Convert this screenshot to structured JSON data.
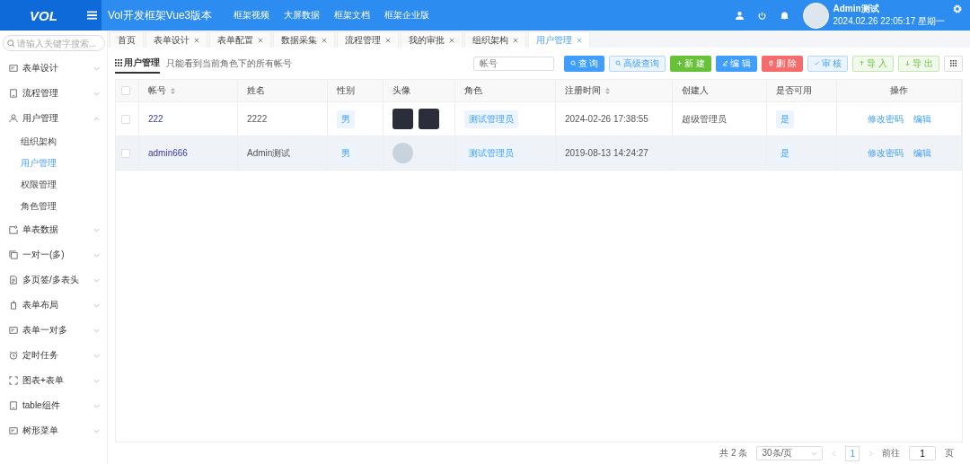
{
  "header": {
    "logo": "VOL",
    "title": "Vol开发框架Vue3版本",
    "nav": [
      "框架视频",
      "大屏数据",
      "框架文档",
      "框架企业版"
    ],
    "user_name": "Admin测试",
    "datetime": "2024.02.26 22:05:17 星期一"
  },
  "sidebar": {
    "search": {
      "placeholder": "请输入关键字搜索..."
    },
    "items": [
      {
        "label": "表单设计",
        "expanded": false
      },
      {
        "label": "流程管理",
        "expanded": false
      },
      {
        "label": "用户管理",
        "expanded": true,
        "children": [
          {
            "label": "组织架构",
            "selected": false
          },
          {
            "label": "用户管理",
            "selected": true
          },
          {
            "label": "权限管理",
            "selected": false
          },
          {
            "label": "角色管理",
            "selected": false
          }
        ]
      },
      {
        "label": "单表数据",
        "expanded": false
      },
      {
        "label": "一对一(多)",
        "expanded": false
      },
      {
        "label": "多页签/多表头",
        "expanded": false
      },
      {
        "label": "表单布局",
        "expanded": false
      },
      {
        "label": "表单一对多",
        "expanded": false
      },
      {
        "label": "定时任务",
        "expanded": false
      },
      {
        "label": "图表+表单",
        "expanded": false
      },
      {
        "label": "table组件",
        "expanded": false
      },
      {
        "label": "树形菜单",
        "expanded": false
      }
    ]
  },
  "tabs": [
    {
      "label": "首页",
      "closable": false,
      "selected": false
    },
    {
      "label": "表单设计",
      "closable": true,
      "selected": false
    },
    {
      "label": "表单配置",
      "closable": true,
      "selected": false
    },
    {
      "label": "数据采集",
      "closable": true,
      "selected": false
    },
    {
      "label": "流程管理",
      "closable": true,
      "selected": false
    },
    {
      "label": "我的审批",
      "closable": true,
      "selected": false
    },
    {
      "label": "组织架构",
      "closable": true,
      "selected": false
    },
    {
      "label": "用户管理",
      "closable": true,
      "selected": true
    }
  ],
  "toolbar": {
    "title": "用户管理",
    "description": "只能看到当前角色下的所有帐号",
    "search": {
      "placeholder": "帐号"
    },
    "buttons": [
      {
        "kind": "search",
        "label": "查 询"
      },
      {
        "kind": "advanced",
        "label": "高级查询"
      },
      {
        "kind": "create",
        "label": "新 建"
      },
      {
        "kind": "edit",
        "label": "编 辑"
      },
      {
        "kind": "delete",
        "label": "删 除"
      },
      {
        "kind": "audit",
        "label": "审 核"
      },
      {
        "kind": "import",
        "label": "导 入"
      },
      {
        "kind": "export",
        "label": "导 出"
      }
    ]
  },
  "table": {
    "select_all_checked": false,
    "columns": [
      {
        "label": "帐号",
        "sortable": true
      },
      {
        "label": "姓名",
        "sortable": false
      },
      {
        "label": "性别",
        "sortable": false
      },
      {
        "label": "头像",
        "sortable": false
      },
      {
        "label": "角色",
        "sortable": false
      },
      {
        "label": "注册时间",
        "sortable": true
      },
      {
        "label": "创建人",
        "sortable": false
      },
      {
        "label": "是否可用",
        "sortable": false
      },
      {
        "label": "操作",
        "sortable": false
      }
    ],
    "rows": [
      {
        "checked": false,
        "hovered": false,
        "account": "222",
        "name": "2222",
        "gender": "男",
        "role": "测试管理员",
        "registered": "2024-02-26 17:38:55",
        "creator": "超级管理员",
        "enabled": "是",
        "actions": [
          "修改密码",
          "编辑"
        ]
      },
      {
        "checked": false,
        "hovered": true,
        "account": "admin666",
        "name": "Admin测试",
        "gender": "男",
        "role": "测试管理员",
        "registered": "2019-08-13 14:24:27",
        "creator": "",
        "enabled": "是",
        "actions": [
          "修改密码",
          "编辑"
        ]
      }
    ]
  },
  "pagination": {
    "total": "共 2 条",
    "page_size": "30条/页",
    "pages": [
      {
        "label": "1",
        "selected": true
      }
    ],
    "goto_label": "前往",
    "goto_value": "1",
    "goto_suffix": "页"
  }
}
